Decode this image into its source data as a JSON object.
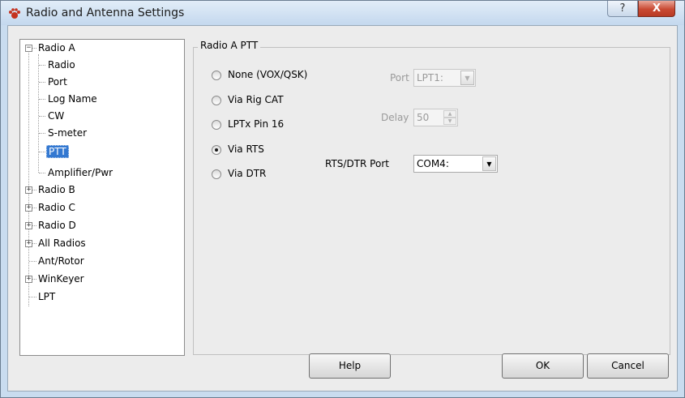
{
  "window": {
    "title": "Radio and Antenna Settings",
    "help_glyph": "?",
    "close_glyph": "X"
  },
  "tree": {
    "items": [
      {
        "label": "Radio A",
        "expander": "−"
      },
      {
        "label": "Radio"
      },
      {
        "label": "Port"
      },
      {
        "label": "Log Name"
      },
      {
        "label": "CW"
      },
      {
        "label": "S-meter"
      },
      {
        "label": "PTT",
        "selected": true
      },
      {
        "label": "Amplifier/Pwr"
      },
      {
        "label": "Radio B",
        "expander": "+"
      },
      {
        "label": "Radio C",
        "expander": "+"
      },
      {
        "label": "Radio D",
        "expander": "+"
      },
      {
        "label": "All Radios",
        "expander": "+"
      },
      {
        "label": "Ant/Rotor"
      },
      {
        "label": "WinKeyer",
        "expander": "+"
      },
      {
        "label": "LPT"
      }
    ]
  },
  "ptt": {
    "group_label": "Radio A PTT",
    "options": [
      {
        "label": "None (VOX/QSK)",
        "checked": false
      },
      {
        "label": "Via Rig CAT",
        "checked": false
      },
      {
        "label": "LPTx Pin 16",
        "checked": false
      },
      {
        "label": "Via RTS",
        "checked": true
      },
      {
        "label": "Via DTR",
        "checked": false
      }
    ],
    "port_label": "Port",
    "port_value": "LPT1:",
    "delay_label": "Delay",
    "delay_value": "50",
    "rts_dtr_label": "RTS/DTR Port",
    "rts_dtr_value": "COM4:"
  },
  "buttons": {
    "help": "Help",
    "ok": "OK",
    "cancel": "Cancel"
  },
  "icons": {
    "app": "paw-icon",
    "dropdown": "chevron-down-icon"
  }
}
